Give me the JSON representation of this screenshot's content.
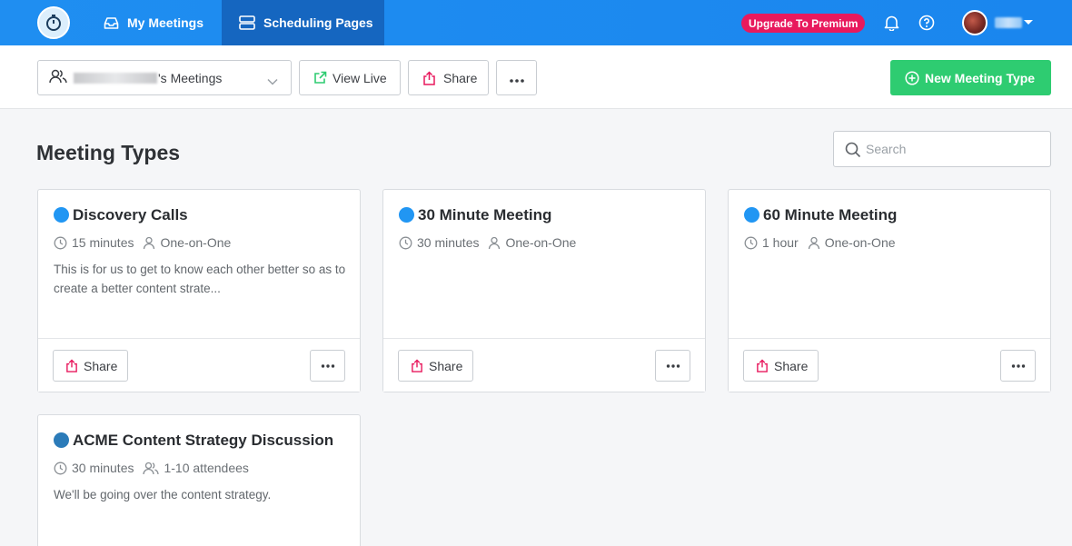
{
  "nav": {
    "my_meetings": "My Meetings",
    "scheduling_pages": "Scheduling Pages",
    "upgrade": "Upgrade To Premium"
  },
  "toolbar": {
    "owner_suffix": "'s Meetings",
    "view_live": "View Live",
    "share": "Share",
    "new_meeting_type": "New Meeting Type"
  },
  "main": {
    "title": "Meeting Types",
    "search_placeholder": "Search"
  },
  "cards": [
    {
      "title": "Discovery Calls",
      "duration": "15 minutes",
      "kind": "One-on-One",
      "description": "This is for us to get to know each other better so as to create a better content strate...",
      "color": "#2196f3",
      "share": "Share"
    },
    {
      "title": "30 Minute Meeting",
      "duration": "30 minutes",
      "kind": "One-on-One",
      "description": "",
      "color": "#2196f3",
      "share": "Share"
    },
    {
      "title": "60 Minute Meeting",
      "duration": "1 hour",
      "kind": "One-on-One",
      "description": "",
      "color": "#2196f3",
      "share": "Share"
    },
    {
      "title": "ACME Content Strategy Discussion",
      "duration": "30 minutes",
      "kind": "1-10 attendees",
      "description": "We'll be going over the content strategy.",
      "color": "#2b7bb9",
      "share": "Share"
    }
  ],
  "colors": {
    "topbar": "#1f8ef1",
    "active_tab": "#1566c0",
    "upgrade_badge": "#e8195d",
    "new_button": "#2ecc71"
  }
}
